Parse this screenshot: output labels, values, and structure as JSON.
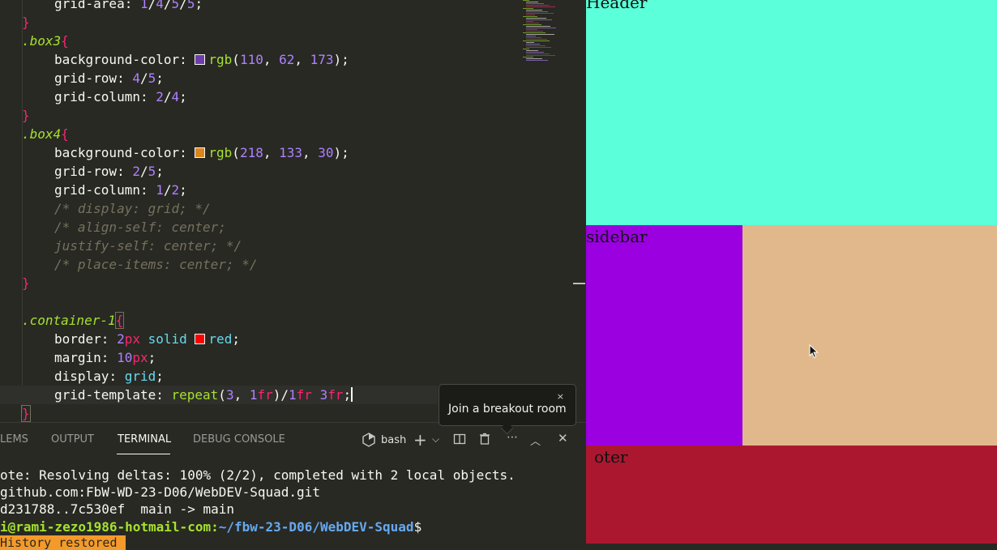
{
  "editor": {
    "code_lines": [
      {
        "indent": 2,
        "tokens": [
          {
            "c": "prop",
            "t": "grid-area"
          },
          {
            "c": "colon",
            "t": ": "
          },
          {
            "c": "num",
            "t": "1"
          },
          {
            "c": "punc",
            "t": "/"
          },
          {
            "c": "num",
            "t": "4"
          },
          {
            "c": "punc",
            "t": "/"
          },
          {
            "c": "num",
            "t": "5"
          },
          {
            "c": "punc",
            "t": "/"
          },
          {
            "c": "num",
            "t": "5"
          },
          {
            "c": "punc",
            "t": ";"
          }
        ]
      },
      {
        "indent": 1,
        "tokens": [
          {
            "c": "brace",
            "t": "}"
          }
        ]
      },
      {
        "indent": 1,
        "tokens": [
          {
            "c": "sel",
            "t": ".box3"
          },
          {
            "c": "brace",
            "t": "{"
          }
        ]
      },
      {
        "indent": 2,
        "tokens": [
          {
            "c": "prop",
            "t": "background-color"
          },
          {
            "c": "colon",
            "t": ": "
          },
          {
            "c": "swatch",
            "t": "#6e3ead"
          },
          {
            "c": "fn",
            "t": "rgb"
          },
          {
            "c": "punc",
            "t": "("
          },
          {
            "c": "num",
            "t": "110"
          },
          {
            "c": "punc",
            "t": ", "
          },
          {
            "c": "num",
            "t": "62"
          },
          {
            "c": "punc",
            "t": ", "
          },
          {
            "c": "num",
            "t": "173"
          },
          {
            "c": "punc",
            "t": ");"
          }
        ]
      },
      {
        "indent": 2,
        "tokens": [
          {
            "c": "prop",
            "t": "grid-row"
          },
          {
            "c": "colon",
            "t": ": "
          },
          {
            "c": "num",
            "t": "4"
          },
          {
            "c": "punc",
            "t": "/"
          },
          {
            "c": "num",
            "t": "5"
          },
          {
            "c": "punc",
            "t": ";"
          }
        ]
      },
      {
        "indent": 2,
        "tokens": [
          {
            "c": "prop",
            "t": "grid-column"
          },
          {
            "c": "colon",
            "t": ": "
          },
          {
            "c": "num",
            "t": "2"
          },
          {
            "c": "punc",
            "t": "/"
          },
          {
            "c": "num",
            "t": "4"
          },
          {
            "c": "punc",
            "t": ";"
          }
        ]
      },
      {
        "indent": 1,
        "tokens": [
          {
            "c": "brace",
            "t": "}"
          }
        ]
      },
      {
        "indent": 1,
        "tokens": [
          {
            "c": "sel",
            "t": ".box4"
          },
          {
            "c": "brace",
            "t": "{"
          }
        ]
      },
      {
        "indent": 2,
        "tokens": [
          {
            "c": "prop",
            "t": "background-color"
          },
          {
            "c": "colon",
            "t": ": "
          },
          {
            "c": "swatch",
            "t": "#da851e"
          },
          {
            "c": "fn",
            "t": "rgb"
          },
          {
            "c": "punc",
            "t": "("
          },
          {
            "c": "num",
            "t": "218"
          },
          {
            "c": "punc",
            "t": ", "
          },
          {
            "c": "num",
            "t": "133"
          },
          {
            "c": "punc",
            "t": ", "
          },
          {
            "c": "num",
            "t": "30"
          },
          {
            "c": "punc",
            "t": ");"
          }
        ]
      },
      {
        "indent": 2,
        "tokens": [
          {
            "c": "prop",
            "t": "grid-row"
          },
          {
            "c": "colon",
            "t": ": "
          },
          {
            "c": "num",
            "t": "2"
          },
          {
            "c": "punc",
            "t": "/"
          },
          {
            "c": "num",
            "t": "5"
          },
          {
            "c": "punc",
            "t": ";"
          }
        ]
      },
      {
        "indent": 2,
        "tokens": [
          {
            "c": "prop",
            "t": "grid-column"
          },
          {
            "c": "colon",
            "t": ": "
          },
          {
            "c": "num",
            "t": "1"
          },
          {
            "c": "punc",
            "t": "/"
          },
          {
            "c": "num",
            "t": "2"
          },
          {
            "c": "punc",
            "t": ";"
          }
        ]
      },
      {
        "indent": 2,
        "tokens": [
          {
            "c": "comment",
            "t": "/* display: grid; */"
          }
        ]
      },
      {
        "indent": 2,
        "tokens": [
          {
            "c": "comment",
            "t": "/* align-self: center;"
          }
        ]
      },
      {
        "indent": 2,
        "tokens": [
          {
            "c": "comment",
            "t": "justify-self: center; */"
          }
        ]
      },
      {
        "indent": 2,
        "tokens": [
          {
            "c": "comment",
            "t": "/* place-items: center; */"
          }
        ]
      },
      {
        "indent": 1,
        "tokens": [
          {
            "c": "brace",
            "t": "}"
          }
        ]
      },
      {
        "indent": 0,
        "tokens": []
      },
      {
        "indent": 1,
        "tokens": [
          {
            "c": "sel",
            "t": ".container-1"
          },
          {
            "c": "brace-hl",
            "t": "{"
          }
        ]
      },
      {
        "indent": 2,
        "tokens": [
          {
            "c": "prop",
            "t": "border"
          },
          {
            "c": "colon",
            "t": ": "
          },
          {
            "c": "num",
            "t": "2"
          },
          {
            "c": "unit",
            "t": "px"
          },
          {
            "c": "punc",
            "t": " "
          },
          {
            "c": "kw",
            "t": "solid"
          },
          {
            "c": "punc",
            "t": " "
          },
          {
            "c": "swatch",
            "t": "#ff0000"
          },
          {
            "c": "kw",
            "t": "red"
          },
          {
            "c": "punc",
            "t": ";"
          }
        ]
      },
      {
        "indent": 2,
        "tokens": [
          {
            "c": "prop",
            "t": "margin"
          },
          {
            "c": "colon",
            "t": ": "
          },
          {
            "c": "num",
            "t": "10"
          },
          {
            "c": "unit",
            "t": "px"
          },
          {
            "c": "punc",
            "t": ";"
          }
        ]
      },
      {
        "indent": 2,
        "tokens": [
          {
            "c": "prop",
            "t": "display"
          },
          {
            "c": "colon",
            "t": ": "
          },
          {
            "c": "kw",
            "t": "grid"
          },
          {
            "c": "punc",
            "t": ";"
          }
        ]
      },
      {
        "indent": 2,
        "active": true,
        "tokens": [
          {
            "c": "prop",
            "t": "grid-template"
          },
          {
            "c": "colon",
            "t": ": "
          },
          {
            "c": "fn",
            "t": "repeat"
          },
          {
            "c": "punc",
            "t": "("
          },
          {
            "c": "num",
            "t": "3"
          },
          {
            "c": "punc",
            "t": ", "
          },
          {
            "c": "num",
            "t": "1"
          },
          {
            "c": "unit",
            "t": "fr"
          },
          {
            "c": "punc",
            "t": ")/"
          },
          {
            "c": "num",
            "t": "1"
          },
          {
            "c": "unit",
            "t": "fr"
          },
          {
            "c": "punc",
            "t": " "
          },
          {
            "c": "num",
            "t": "3"
          },
          {
            "c": "unit",
            "t": "fr"
          },
          {
            "c": "punc",
            "t": ";"
          },
          {
            "c": "cursor",
            "t": ""
          }
        ]
      },
      {
        "indent": 1,
        "tokens": [
          {
            "c": "brace-hl",
            "t": "}"
          }
        ]
      }
    ]
  },
  "panel": {
    "tabs": [
      {
        "label": "PROBLEMS",
        "shown": "LEMS",
        "active": false
      },
      {
        "label": "OUTPUT",
        "shown": "OUTPUT",
        "active": false
      },
      {
        "label": "TERMINAL",
        "shown": "TERMINAL",
        "active": true
      },
      {
        "label": "DEBUG CONSOLE",
        "shown": "DEBUG CONSOLE",
        "active": false
      }
    ],
    "shell_name": "bash",
    "icons": [
      "terminal-icon",
      "plus-icon",
      "chevron-down-icon",
      "split-icon",
      "trash-icon",
      "more-icon",
      "maximize-icon",
      "close-icon"
    ]
  },
  "terminal": {
    "lines": [
      "ote: Resolving deltas: 100% (2/2), completed with 2 local objects.",
      "github.com:FbW-WD-23-D06/WebDEV-Squad.git",
      "d231788..7c530ef  main -> main"
    ],
    "prompt_user": "i@rami-zezo1986-hotmail-com",
    "prompt_sep": ":",
    "prompt_path": "~/fbw-23-D06/WebDEV-Squad",
    "prompt_symbol": "$",
    "history_badge": "History restored"
  },
  "tooltip": {
    "text": "Join a breakout room",
    "close": "×"
  },
  "preview": {
    "header_label": "Header",
    "sidebar_label": "sidebar",
    "footer_label": "oter",
    "colors": {
      "header": "#5bffd9",
      "sidebar": "#9b00e0",
      "main": "#e1b88c",
      "footer": "#ac1730"
    }
  }
}
